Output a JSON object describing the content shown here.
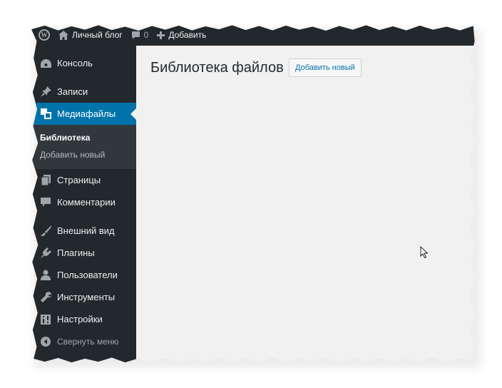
{
  "admin_bar": {
    "site_name": "Личный блог",
    "comments_count": "0",
    "new_label": "Добавить"
  },
  "sidebar": {
    "items": [
      {
        "label": "Консоль",
        "icon": "dashboard-icon"
      },
      {
        "label": "Записи",
        "icon": "pin-icon"
      },
      {
        "label": "Медиафайлы",
        "icon": "media-icon",
        "current": true
      },
      {
        "label": "Страницы",
        "icon": "pages-icon"
      },
      {
        "label": "Комментарии",
        "icon": "comment-icon"
      },
      {
        "label": "Внешний вид",
        "icon": "brush-icon"
      },
      {
        "label": "Плагины",
        "icon": "plugin-icon"
      },
      {
        "label": "Пользователи",
        "icon": "users-icon"
      },
      {
        "label": "Инструменты",
        "icon": "wrench-icon"
      },
      {
        "label": "Настройки",
        "icon": "settings-icon"
      }
    ],
    "submenu": [
      {
        "label": "Библиотека",
        "active": true
      },
      {
        "label": "Добавить новый",
        "active": false
      }
    ],
    "collapse_label": "Свернуть меню"
  },
  "main": {
    "title": "Библиотека файлов",
    "add_new_label": "Добавить новый"
  },
  "colors": {
    "admin_bar": "#23282d",
    "accent": "#0073aa",
    "content_bg": "#f1f1f1"
  }
}
